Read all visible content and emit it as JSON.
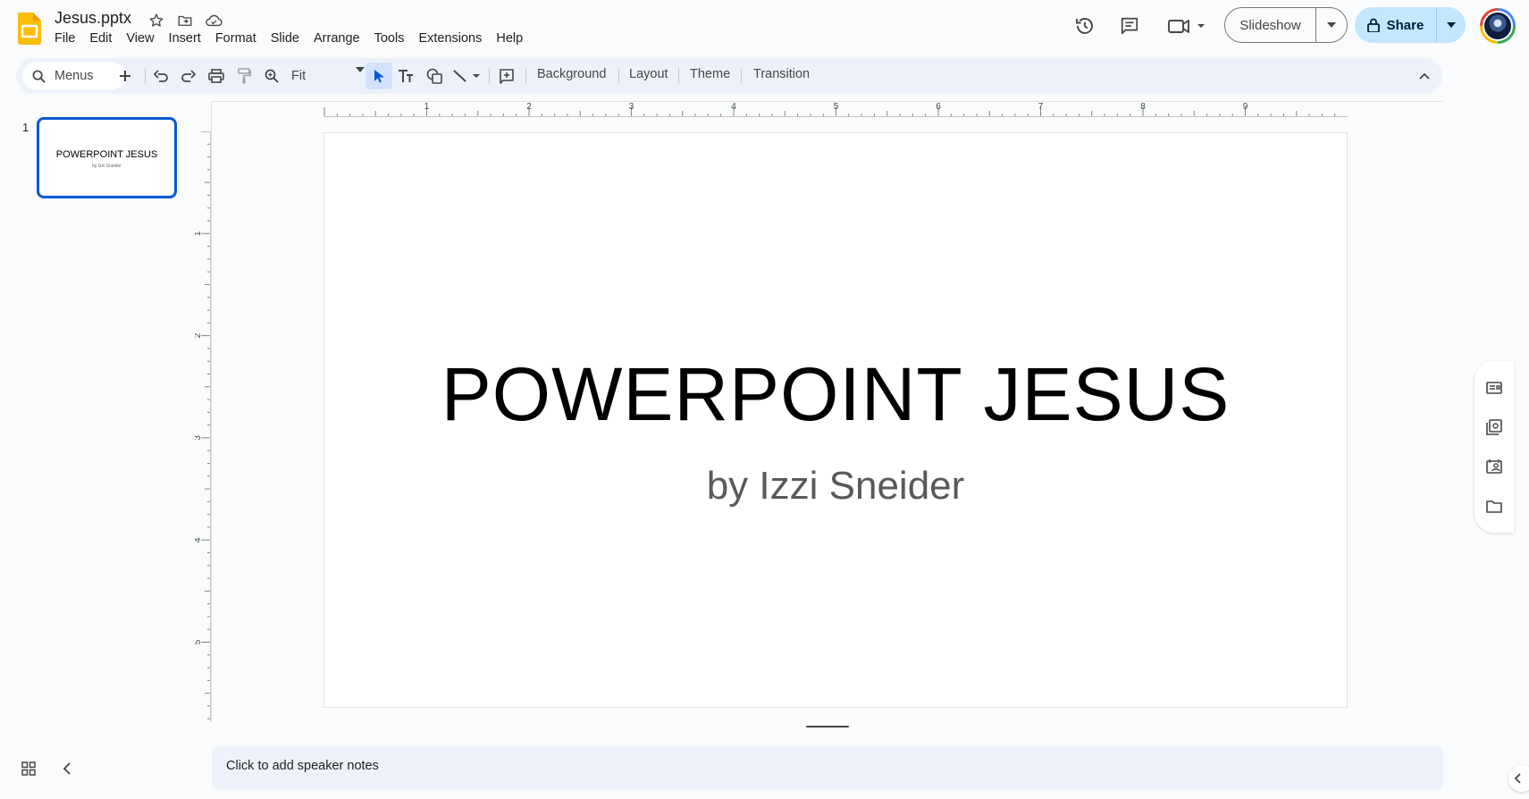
{
  "header": {
    "doc_title": "Jesus.pptx",
    "menu": [
      "File",
      "Edit",
      "View",
      "Insert",
      "Format",
      "Slide",
      "Arrange",
      "Tools",
      "Extensions",
      "Help"
    ],
    "slideshow_label": "Slideshow",
    "share_label": "Share"
  },
  "toolbar": {
    "search_label": "Menus",
    "zoom_value": "Fit",
    "background_label": "Background",
    "layout_label": "Layout",
    "theme_label": "Theme",
    "transition_label": "Transition"
  },
  "ruler": {
    "horizontal_labels": [
      "1",
      "2",
      "3",
      "4",
      "5",
      "6",
      "7",
      "8",
      "9"
    ],
    "vertical_labels": [
      "1",
      "2",
      "3",
      "4",
      "5"
    ]
  },
  "filmstrip": {
    "slides": [
      {
        "number": "1",
        "title": "POWERPOINT JESUS",
        "subtitle": "by Izzi Sneider"
      }
    ]
  },
  "slide": {
    "title": "POWERPOINT JESUS",
    "subtitle": "by Izzi Sneider"
  },
  "notes": {
    "placeholder": "Click to add speaker notes"
  },
  "colors": {
    "accent": "#0b57d0",
    "share_bg": "#c2e7ff",
    "app_bg": "#f9fbfd",
    "toolbar_bg": "#edf2fa",
    "logo": "#fbbc04"
  }
}
